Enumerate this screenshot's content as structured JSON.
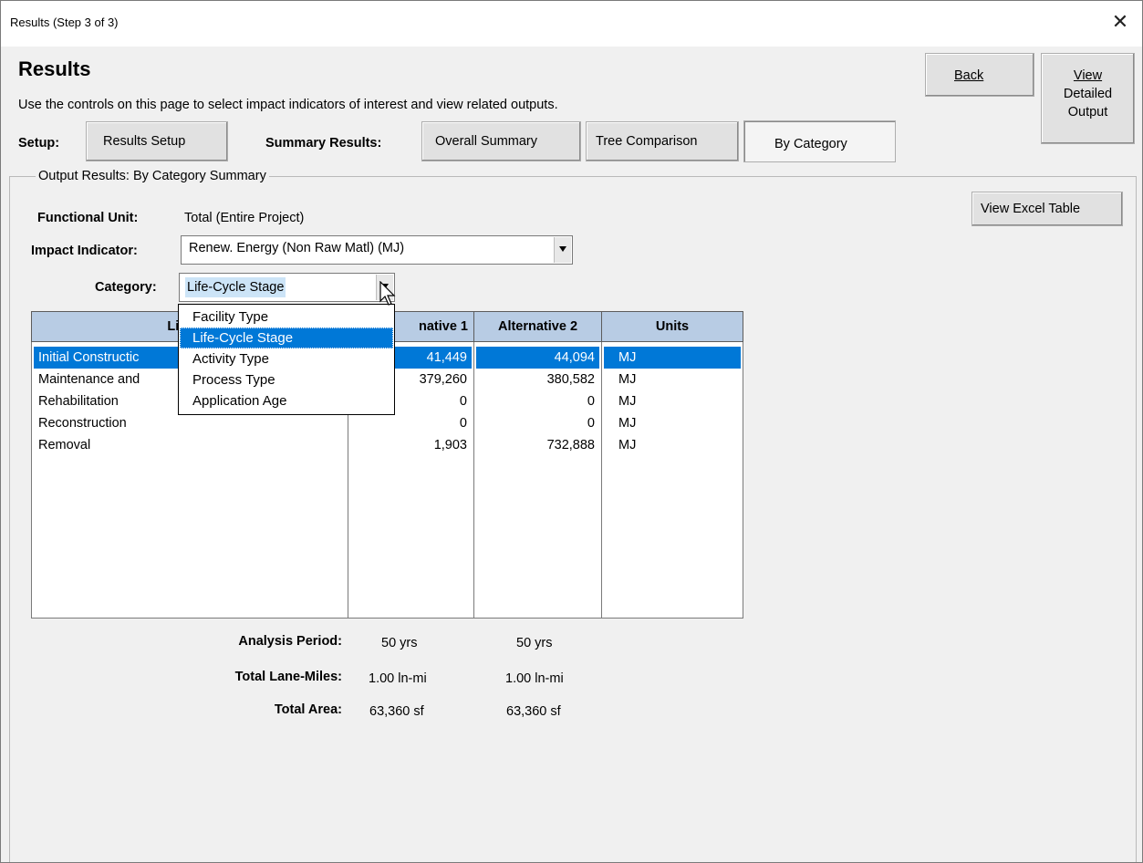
{
  "window": {
    "title": "Results (Step 3 of 3)",
    "close_glyph": "✕"
  },
  "header": {
    "title": "Results",
    "subtitle": "Use the controls on this page to select impact indicators of interest and view related outputs."
  },
  "top_buttons": {
    "back": "Back",
    "view_detailed_line1": "View",
    "view_detailed_line2": "Detailed",
    "view_detailed_line3": "Output"
  },
  "setup": {
    "label": "Setup:",
    "results_setup": "Results Setup"
  },
  "summary": {
    "label": "Summary Results:",
    "overall_summary": "Overall Summary",
    "tree_comparison": "Tree Comparison",
    "by_category": "By Category"
  },
  "output_group": {
    "title": "Output Results: By Category Summary",
    "view_excel_table": "View Excel Table",
    "functional_unit_label": "Functional Unit:",
    "functional_unit_value": "Total (Entire Project)",
    "impact_indicator_label": "Impact Indicator:",
    "impact_indicator_value": "Renew. Energy (Non Raw Matl) (MJ)",
    "category_label": "Category:",
    "category_value": "Life-Cycle Stage"
  },
  "category_dropdown": {
    "options": [
      "Facility Type",
      "Life-Cycle Stage",
      "Activity Type",
      "Process Type",
      "Application Age"
    ],
    "selected_index": 1
  },
  "table": {
    "headers": [
      "Life-Cy",
      "native 1",
      "Alternative 2",
      "Units"
    ],
    "rows": [
      {
        "stage": "Initial Constructic",
        "alt1": "41,449",
        "alt2": "44,094",
        "units": "MJ"
      },
      {
        "stage": "Maintenance and",
        "alt1": "379,260",
        "alt2": "380,582",
        "units": "MJ"
      },
      {
        "stage": "Rehabilitation",
        "alt1": "0",
        "alt2": "0",
        "units": "MJ"
      },
      {
        "stage": "Reconstruction",
        "alt1": "0",
        "alt2": "0",
        "units": "MJ"
      },
      {
        "stage": "Removal",
        "alt1": "1,903",
        "alt2": "732,888",
        "units": "MJ"
      }
    ],
    "selected_row": 0
  },
  "info": {
    "analysis_period_label": "Analysis Period:",
    "analysis_period_alt1": "50 yrs",
    "analysis_period_alt2": "50 yrs",
    "lane_miles_label": "Total Lane-Miles:",
    "lane_miles_alt1": "1.00 ln-mi",
    "lane_miles_alt2": "1.00 ln-mi",
    "area_label": "Total Area:",
    "area_alt1": "63,360 sf",
    "area_alt2": "63,360 sf"
  },
  "colors": {
    "window_bg": "#f0f0f0",
    "header_blue": "#b8cce4",
    "selection_blue": "#0078d7"
  }
}
